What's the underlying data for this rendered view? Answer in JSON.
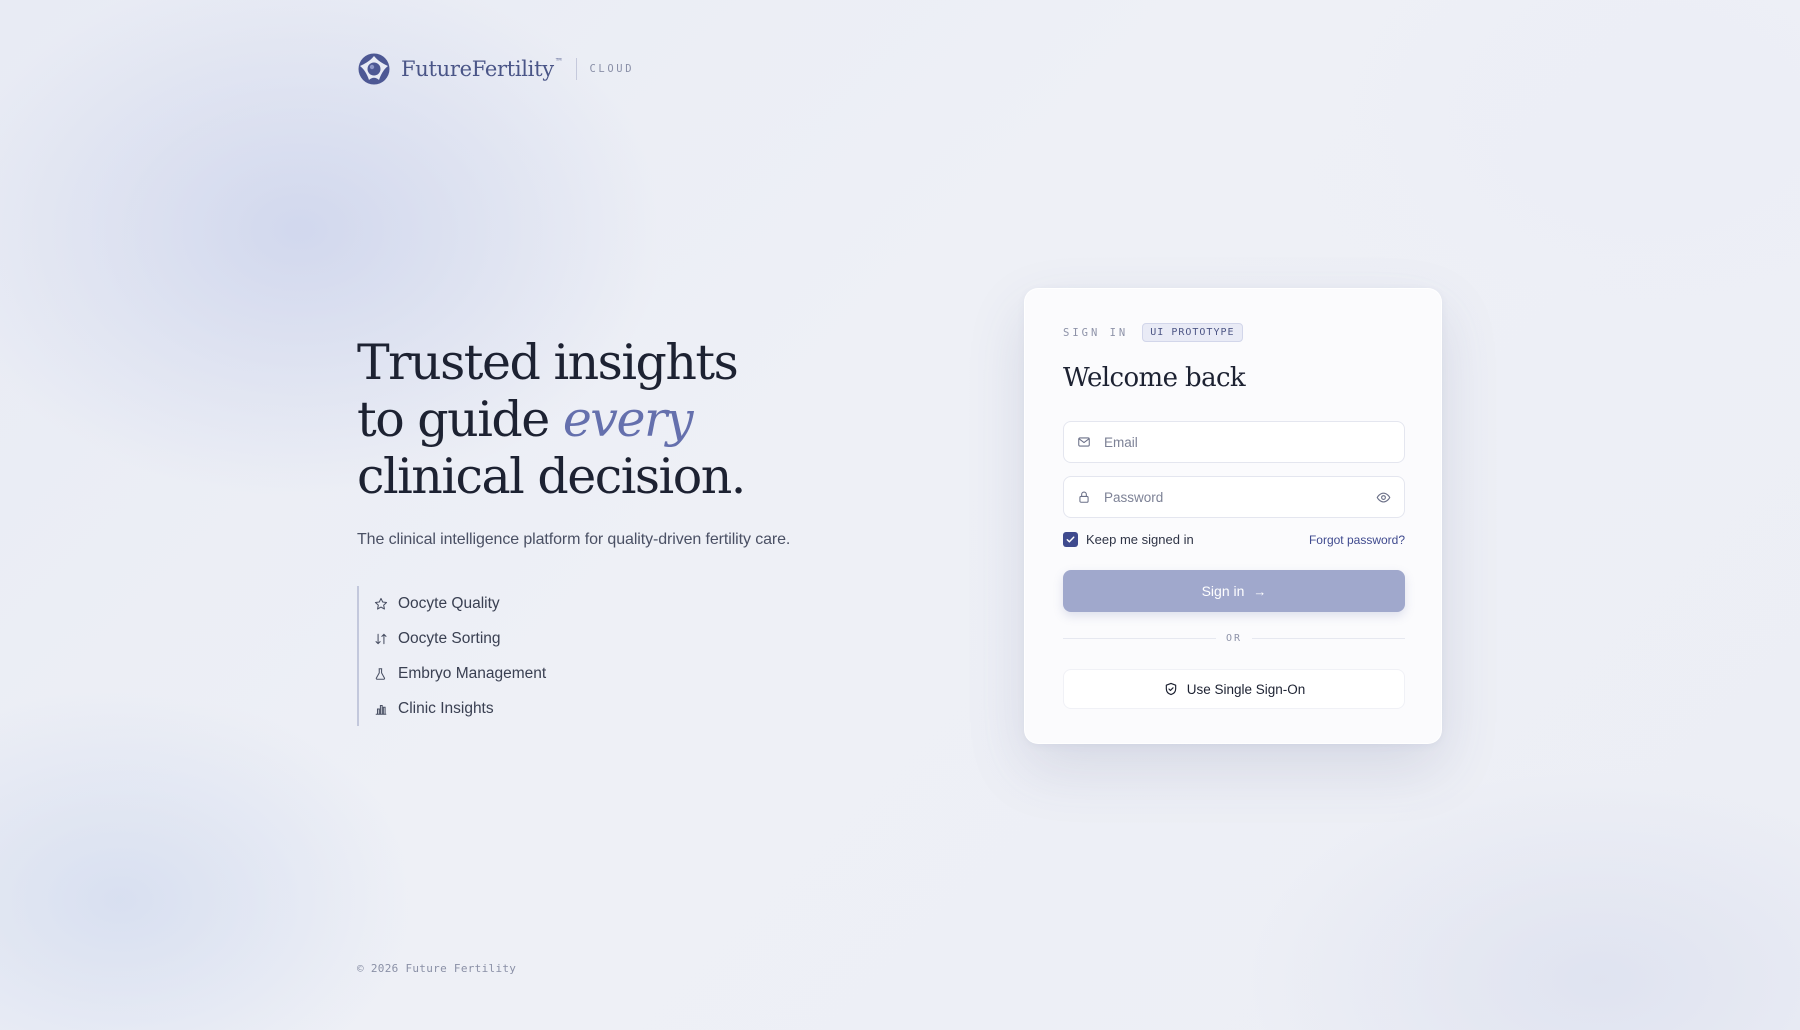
{
  "brand": {
    "name": "FutureFertility",
    "tm": "™",
    "product": "CLOUD",
    "color": "#4a5587"
  },
  "hero": {
    "headline_line1": "Trusted insights",
    "headline_line2_pre": "to guide ",
    "headline_accent": "every",
    "headline_line3": "clinical decision.",
    "tagline": "The clinical intelligence platform for quality-driven fertility care.",
    "accent_color": "#6570ad"
  },
  "features": [
    {
      "label": "Oocyte Quality",
      "icon": "star-icon"
    },
    {
      "label": "Oocyte Sorting",
      "icon": "sort-arrows-icon"
    },
    {
      "label": "Embryo Management",
      "icon": "flask-icon"
    },
    {
      "label": "Clinic Insights",
      "icon": "bar-chart-icon"
    }
  ],
  "footer": {
    "copyright": "© 2026 Future Fertility"
  },
  "card": {
    "eyebrow": "SIGN IN",
    "badge": "UI PROTOTYPE",
    "title": "Welcome back",
    "email": {
      "placeholder": "Email",
      "value": "",
      "icon": "mail-icon"
    },
    "password": {
      "placeholder": "Password",
      "value": "",
      "icon": "lock-icon",
      "toggle_icon": "eye-icon"
    },
    "remember": {
      "label": "Keep me signed in",
      "checked": true
    },
    "forgot_label": "Forgot password?",
    "signin_label": "Sign in",
    "signin_arrow": "→",
    "or_label": "OR",
    "sso_label": "Use Single Sign-On",
    "sso_icon": "shield-check-icon",
    "primary_color": "#3f4a8e",
    "button_color": "#a0a8cc"
  }
}
